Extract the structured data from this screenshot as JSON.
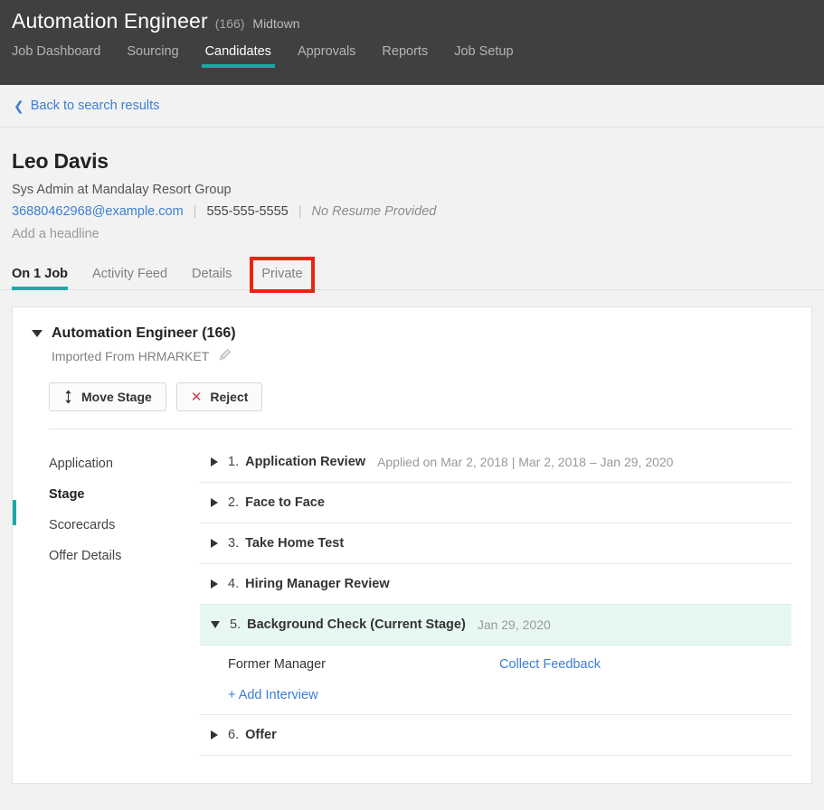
{
  "header": {
    "job_title": "Automation Engineer",
    "job_count": "(166)",
    "location": "Midtown",
    "nav_tabs": [
      {
        "label": "Job Dashboard",
        "active": false
      },
      {
        "label": "Sourcing",
        "active": false
      },
      {
        "label": "Candidates",
        "active": true
      },
      {
        "label": "Approvals",
        "active": false
      },
      {
        "label": "Reports",
        "active": false
      },
      {
        "label": "Job Setup",
        "active": false
      }
    ]
  },
  "back_bar": {
    "chevron_icon": "chevron-left-icon",
    "label": "Back to search results"
  },
  "candidate": {
    "name": "Leo Davis",
    "role": "Sys Admin at Mandalay Resort Group",
    "email": "36880462968@example.com",
    "phone": "555-555-5555",
    "resume_status": "No Resume Provided",
    "separator": "|",
    "add_headline": "Add a headline"
  },
  "profile_tabs": [
    {
      "label": "On 1 Job",
      "active": true,
      "highlighted": false
    },
    {
      "label": "Activity Feed",
      "active": false,
      "highlighted": false
    },
    {
      "label": "Details",
      "active": false,
      "highlighted": false
    },
    {
      "label": "Private",
      "active": false,
      "highlighted": true
    }
  ],
  "card": {
    "title": "Automation Engineer (166)",
    "subtitle": "Imported From HRMARKET",
    "edit_icon": "pencil-icon",
    "buttons": [
      {
        "label": "Move Stage",
        "icon": "move-updown-icon"
      },
      {
        "label": "Reject",
        "icon": "close-x-icon"
      }
    ],
    "subnav": [
      {
        "label": "Application",
        "active": false
      },
      {
        "label": "Stage",
        "active": true
      },
      {
        "label": "Scorecards",
        "active": false
      },
      {
        "label": "Offer Details",
        "active": false
      }
    ],
    "stages": [
      {
        "number": "1.",
        "name": "Application Review",
        "meta": "Applied on Mar 2, 2018 | Mar 2, 2018 – Jan 29, 2020",
        "expanded": false,
        "current": false
      },
      {
        "number": "2.",
        "name": "Face to Face",
        "meta": "",
        "expanded": false,
        "current": false
      },
      {
        "number": "3.",
        "name": "Take Home Test",
        "meta": "",
        "expanded": false,
        "current": false
      },
      {
        "number": "4.",
        "name": "Hiring Manager Review",
        "meta": "",
        "expanded": false,
        "current": false
      },
      {
        "number": "5.",
        "name": "Background Check (Current Stage)",
        "meta": "Jan 29, 2020",
        "expanded": true,
        "current": true
      },
      {
        "number": "6.",
        "name": "Offer",
        "meta": "",
        "expanded": false,
        "current": false
      }
    ],
    "stage_detail": {
      "interview_label": "Former Manager",
      "collect_feedback": "Collect Feedback",
      "add_interview": "+ Add Interview"
    }
  },
  "colors": {
    "header_bg": "#404040",
    "accent_teal": "#16aca4",
    "link_blue": "#3b7dd8",
    "reject_red": "#e0384f",
    "highlight_red": "#ee2211",
    "current_stage_bg": "#e6f7f4"
  }
}
